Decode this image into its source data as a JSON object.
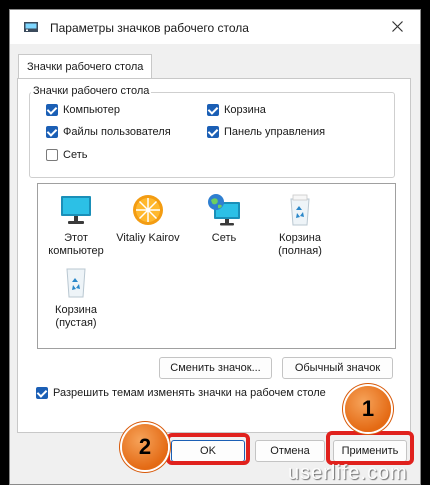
{
  "window": {
    "title": "Параметры значков рабочего стола"
  },
  "tab": {
    "label": "Значки рабочего стола"
  },
  "group": {
    "legend": "Значки рабочего стола",
    "checkboxes": [
      {
        "label": "Компьютер",
        "checked": true
      },
      {
        "label": "Корзина",
        "checked": true
      },
      {
        "label": "Файлы пользователя",
        "checked": true
      },
      {
        "label": "Панель управления",
        "checked": true
      },
      {
        "label": "Сеть",
        "checked": false
      }
    ]
  },
  "icons": [
    {
      "label": "Этот компьютер",
      "icon": "monitor-icon"
    },
    {
      "label": "Vitaliy Kairov",
      "icon": "user-folder-icon"
    },
    {
      "label": "Сеть",
      "icon": "network-icon"
    },
    {
      "label": "Корзина (полная)",
      "icon": "recycle-bin-full-icon"
    },
    {
      "label": "Корзина (пустая)",
      "icon": "recycle-bin-empty-icon"
    }
  ],
  "buttons": {
    "change_icon": "Сменить значок...",
    "default_icon": "Обычный значок",
    "ok": "OK",
    "cancel": "Отмена",
    "apply": "Применить"
  },
  "allow_themes": {
    "label": "Разрешить темам изменять значки на рабочем столе",
    "checked": true
  },
  "annotations": {
    "badge_1": "1",
    "badge_2": "2"
  },
  "watermark": "userlife.com",
  "colors": {
    "accent": "#1b5fb5",
    "highlight": "#e0211d",
    "badge": "#e46a14"
  }
}
